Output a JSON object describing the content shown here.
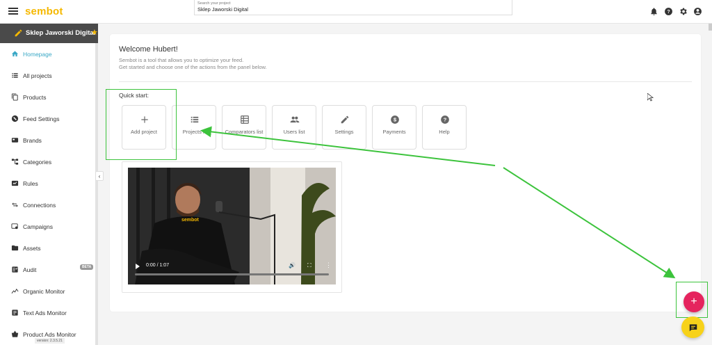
{
  "app": {
    "logo": "sembot"
  },
  "search": {
    "label": "Search your project",
    "value": "Sklep Jaworski Digital"
  },
  "header_icons": [
    "bell-icon",
    "help-icon",
    "gear-icon",
    "account-icon"
  ],
  "project": {
    "name": "Sklep Jaworski Digital"
  },
  "sidebar": {
    "items": [
      {
        "label": "Homepage",
        "icon": "home-icon",
        "active": true
      },
      {
        "label": "All projects",
        "icon": "list-icon"
      },
      {
        "label": "Products",
        "icon": "copy-icon"
      },
      {
        "label": "Feed Settings",
        "icon": "feed-icon"
      },
      {
        "label": "Brands",
        "icon": "brand-icon"
      },
      {
        "label": "Categories",
        "icon": "tree-icon"
      },
      {
        "label": "Rules",
        "icon": "rules-icon"
      },
      {
        "label": "Connections",
        "icon": "swap-icon"
      },
      {
        "label": "Campaigns",
        "icon": "campaign-icon"
      },
      {
        "label": "Assets",
        "icon": "folder-icon"
      },
      {
        "label": "Audit",
        "icon": "audit-icon",
        "badge": "BETA"
      },
      {
        "label": "Organic Monitor",
        "icon": "chart-line-icon"
      },
      {
        "label": "Text Ads Monitor",
        "icon": "text-ads-icon"
      },
      {
        "label": "Product Ads Monitor",
        "icon": "basket-icon"
      }
    ],
    "version": "version: 2.3.5.21"
  },
  "main": {
    "welcome": "Welcome Hubert!",
    "intro_line1": "Sembot is a tool that allows you to optimize your feed.",
    "intro_line2": "Get started and choose one of the actions from the panel below.",
    "quick_start": "Quick start:",
    "tiles": [
      {
        "label": "Add project",
        "icon": "plus-icon"
      },
      {
        "label": "Projects li",
        "icon": "list-icon"
      },
      {
        "label": "Comparators list",
        "icon": "table-icon"
      },
      {
        "label": "Users list",
        "icon": "users-icon"
      },
      {
        "label": "Settings",
        "icon": "pencil-icon"
      },
      {
        "label": "Payments",
        "icon": "dollar-icon"
      },
      {
        "label": "Help",
        "icon": "help-icon"
      }
    ],
    "video": {
      "time": "0:00 / 1:07",
      "shirt_text": "sembot"
    }
  },
  "colors": {
    "accent": "#f5b800",
    "active_nav": "#3aa8c6",
    "fab_add": "#e5245e",
    "fab_chat": "#f7d21a",
    "annotation": "#3cc33c"
  },
  "fab": {
    "add_label": "+"
  }
}
